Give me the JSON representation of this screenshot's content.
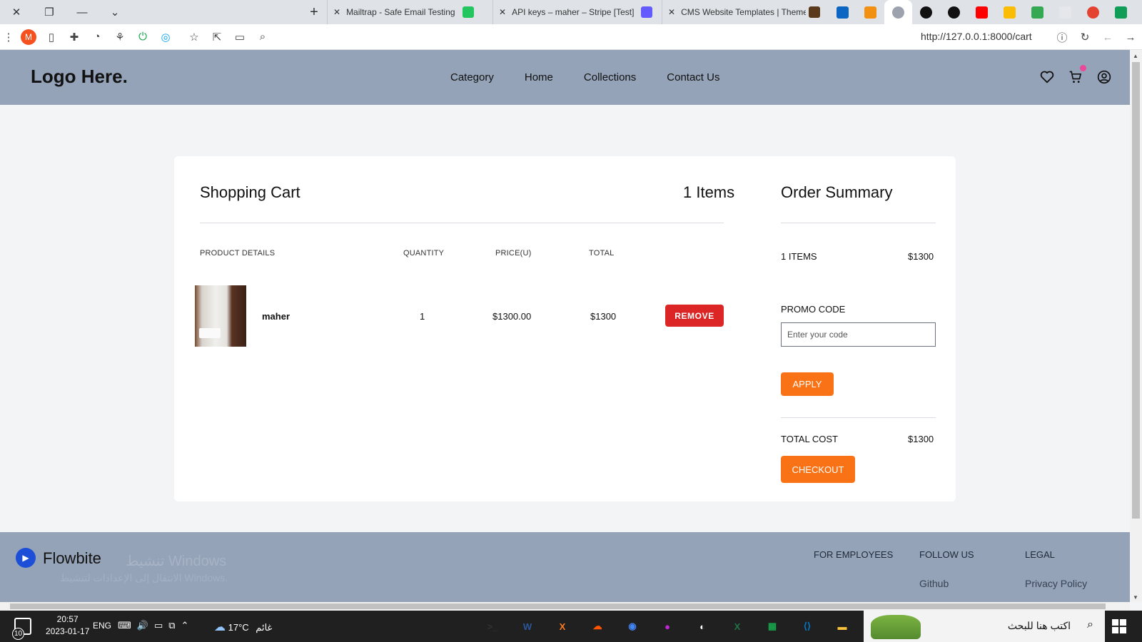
{
  "browser": {
    "tabs": [
      {
        "title": "Mailtrap - Safe Email Testing",
        "fav_color": "#22c55e"
      },
      {
        "title": "API keys – maher – Stripe [Test]",
        "fav_color": "#635bff"
      },
      {
        "title": "CMS Website Templates | Theme",
        "fav_color": "#5a3a1a"
      }
    ],
    "pinned_tabs": [
      {
        "name": "linkedin",
        "color": "#0a66c2"
      },
      {
        "name": "phpmyadmin",
        "color": "#f29111"
      },
      {
        "name": "current",
        "color": "#9ca3af"
      },
      {
        "name": "github-1",
        "color": "#111111"
      },
      {
        "name": "github-2",
        "color": "#111111"
      },
      {
        "name": "youtube",
        "color": "#ff0000"
      },
      {
        "name": "keep",
        "color": "#fbbc04"
      },
      {
        "name": "apps",
        "color": "#34a853"
      },
      {
        "name": "doc",
        "color": "#9ca3af"
      },
      {
        "name": "todoist",
        "color": "#e44332"
      },
      {
        "name": "sheets",
        "color": "#0f9d58"
      }
    ],
    "url": "http://127.0.0.1:8000/cart",
    "extension_letter": "M"
  },
  "header": {
    "logo": "Logo Here.",
    "nav": [
      "Category",
      "Home",
      "Collections",
      "Contact Us"
    ]
  },
  "cart": {
    "title": "Shopping Cart",
    "count_label": "1 Items",
    "columns": {
      "product": "PRODUCT DETAILS",
      "quantity": "QUANTITY",
      "price": "PRICE(U)",
      "total": "TOTAL"
    },
    "items": [
      {
        "name": "maher",
        "quantity": "1",
        "price": "$1300.00",
        "total": "$1300",
        "remove_label": "REMOVE"
      }
    ]
  },
  "summary": {
    "title": "Order Summary",
    "items_label": "1 ITEMS",
    "items_value": "$1300",
    "promo_label": "PROMO CODE",
    "promo_placeholder": "Enter your code",
    "apply_label": "APPLY",
    "total_label": "TOTAL COST",
    "total_value": "$1300",
    "checkout_label": "CHECKOUT"
  },
  "footer": {
    "brand": "Flowbite",
    "watermark_line1": "تنشيط Windows",
    "watermark_line2": "الانتقال إلى الإعدادات لتنشيط Windows.",
    "columns": [
      {
        "heading": "FOR EMPLOYEES",
        "link": ""
      },
      {
        "heading": "FOLLOW US",
        "link": "Github"
      },
      {
        "heading": "LEGAL",
        "link": "Privacy Policy"
      }
    ]
  },
  "taskbar": {
    "notification_count": "10",
    "time": "20:57",
    "date": "2023-01-17",
    "language": "ENG",
    "temperature": "17°C",
    "weather": "غائم",
    "search_placeholder": "اكتب هنا للبحث",
    "apps": [
      {
        "name": "terminal",
        "label": ">_",
        "color": "#333333"
      },
      {
        "name": "word",
        "label": "W",
        "color": "#2b579a"
      },
      {
        "name": "xampp",
        "label": "X",
        "color": "#fb7a24"
      },
      {
        "name": "soundcloud",
        "label": "☁",
        "color": "#ff5500"
      },
      {
        "name": "chrome",
        "label": "◉",
        "color": "#4285f4"
      },
      {
        "name": "drop",
        "label": "●",
        "color": "#c026d3"
      },
      {
        "name": "edge-app",
        "label": "◐",
        "color": "#ffffff"
      },
      {
        "name": "excel",
        "label": "X",
        "color": "#217346"
      },
      {
        "name": "green-app",
        "label": "▦",
        "color": "#16a34a"
      },
      {
        "name": "vscode",
        "label": "⟨⟩",
        "color": "#007acc"
      },
      {
        "name": "explorer",
        "label": "▬",
        "color": "#f8c13c"
      }
    ]
  }
}
